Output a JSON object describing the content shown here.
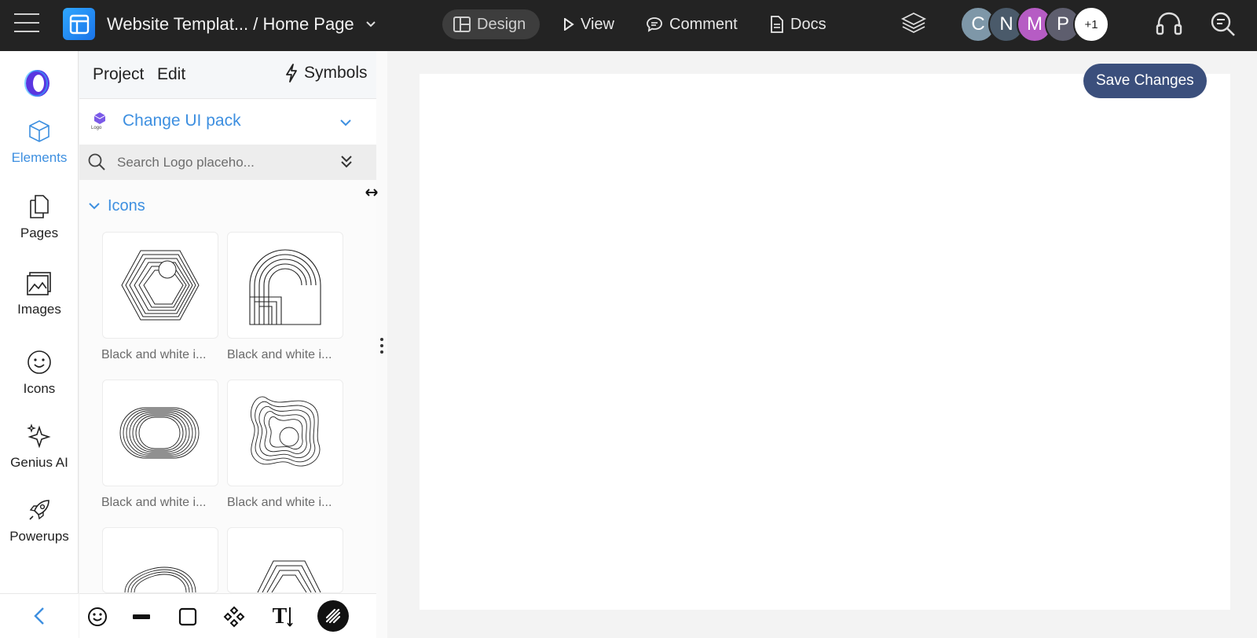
{
  "topbar": {
    "project_title": "Website Templat... / Home Page",
    "nav": [
      {
        "label": "Design",
        "icon": "layout-icon"
      },
      {
        "label": "View",
        "icon": "play-icon"
      },
      {
        "label": "Comment",
        "icon": "comment-icon"
      },
      {
        "label": "Docs",
        "icon": "doc-icon"
      }
    ],
    "avatars": [
      {
        "initial": "C",
        "color": "#7e97a8"
      },
      {
        "initial": "N",
        "color": "#4a5a6a"
      },
      {
        "initial": "M",
        "color": "#b65cc4"
      },
      {
        "initial": "P",
        "color": "#5e5e6e"
      }
    ],
    "extra_count": "+1"
  },
  "rail": {
    "items": [
      {
        "label": "Elements",
        "icon": "cube-icon"
      },
      {
        "label": "Pages",
        "icon": "pages-icon"
      },
      {
        "label": "Images",
        "icon": "image-icon"
      },
      {
        "label": "Icons",
        "icon": "smiley-icon"
      },
      {
        "label": "Genius AI",
        "icon": "sparkle-icon"
      },
      {
        "label": "Powerups",
        "icon": "rocket-icon"
      }
    ]
  },
  "panel": {
    "tabs": {
      "project": "Project",
      "edit": "Edit",
      "symbols": "Symbols"
    },
    "ui_pack": {
      "logo_text": "Logo",
      "label": "Change UI pack"
    },
    "search": {
      "placeholder": "Search Logo placeho..."
    },
    "section": {
      "label": "Icons"
    },
    "cards": [
      {
        "caption": "Black and white i..."
      },
      {
        "caption": "Black and white i..."
      },
      {
        "caption": "Black and white i..."
      },
      {
        "caption": "Black and white i..."
      }
    ],
    "text_tool_label": "T"
  },
  "canvas": {
    "save_label": "Save Changes"
  },
  "colors": {
    "accent": "#3d8fe0",
    "topbar": "#232323",
    "save_button": "#3b4f7c"
  }
}
